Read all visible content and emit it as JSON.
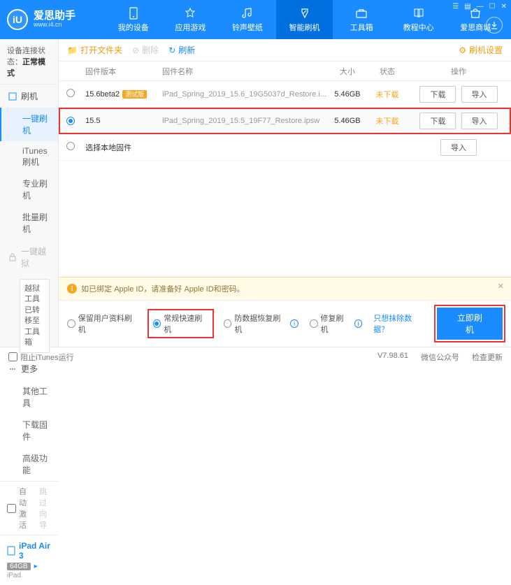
{
  "app": {
    "name": "爱思助手",
    "url": "www.i4.cn",
    "logo_letter": "iU"
  },
  "topnav": [
    {
      "label": "我的设备"
    },
    {
      "label": "应用游戏"
    },
    {
      "label": "铃声壁纸"
    },
    {
      "label": "智能刷机"
    },
    {
      "label": "工具箱"
    },
    {
      "label": "教程中心"
    },
    {
      "label": "爱思商城"
    }
  ],
  "connection": {
    "label": "设备连接状态：",
    "value": "正常模式"
  },
  "sidebar": {
    "flash": {
      "head": "刷机",
      "items": [
        "一键刷机",
        "iTunes刷机",
        "专业刷机",
        "批量刷机"
      ]
    },
    "jailbreak": {
      "head": "一键越狱",
      "note": "越狱工具已转移至工具箱"
    },
    "more": {
      "head": "更多",
      "items": [
        "其他工具",
        "下载固件",
        "高级功能"
      ]
    },
    "auto_activate": "自动激活",
    "skip_guide": "跳过向导"
  },
  "device": {
    "name": "iPad Air 3",
    "capacity": "64GB",
    "type": "iPad"
  },
  "toolbar": {
    "open": "打开文件夹",
    "delete": "删除",
    "refresh": "刷新",
    "settings": "刷机设置"
  },
  "table": {
    "headers": {
      "version": "固件版本",
      "name": "固件名称",
      "size": "大小",
      "status": "状态",
      "ops": "操作"
    },
    "rows": [
      {
        "version": "15.6beta2",
        "badge": "测试版",
        "name": "iPad_Spring_2019_15.6_19G5037d_Restore.i...",
        "size": "5.46GB",
        "status": "未下载",
        "selected": false
      },
      {
        "version": "15.5",
        "badge": "",
        "name": "iPad_Spring_2019_15.5_19F77_Restore.ipsw",
        "size": "5.46GB",
        "status": "未下载",
        "selected": true
      }
    ],
    "local_fw": "选择本地固件",
    "btn_download": "下载",
    "btn_import": "导入"
  },
  "notice": "如已绑定 Apple ID，请准备好 Apple ID和密码。",
  "options": {
    "o1": "保留用户资料刷机",
    "o2": "常规快速刷机",
    "o3": "防数据恢复刷机",
    "o4": "修复刷机",
    "link": "只想抹除数据？",
    "action": "立即刷机"
  },
  "statusbar": {
    "block": "阻止iTunes运行",
    "version": "V7.98.61",
    "wechat": "微信公众号",
    "update": "检查更新"
  }
}
